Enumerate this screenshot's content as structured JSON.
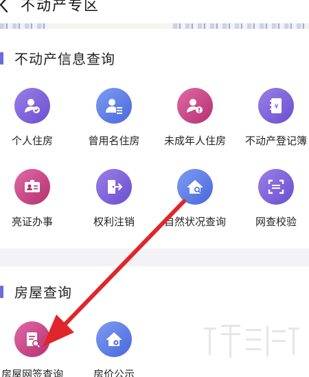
{
  "header": {
    "title": "不动产专区"
  },
  "sections": [
    {
      "title": "不动产信息查询",
      "items": [
        {
          "label": "个人住房",
          "icon": "person-house-icon",
          "color": "#7b5fd6"
        },
        {
          "label": "曾用名住房",
          "icon": "person-list-icon",
          "color": "#5f7fe8"
        },
        {
          "label": "未成年人住房",
          "icon": "child-alert-icon",
          "color": "#c8448a"
        },
        {
          "label": "不动产登记簿",
          "icon": "register-book-icon",
          "color": "#7b5fd6"
        },
        {
          "label": "亮证办事",
          "icon": "id-card-icon",
          "color": "#c8448a"
        },
        {
          "label": "权利注销",
          "icon": "logout-door-icon",
          "color": "#7b5fd6"
        },
        {
          "label": "自然状况查询",
          "icon": "house-search-icon",
          "color": "#5f7fe8"
        },
        {
          "label": "网查校验",
          "icon": "scan-frame-icon",
          "color": "#7b5fd6"
        }
      ]
    },
    {
      "title": "房屋查询",
      "items": [
        {
          "label": "房屋网签查询",
          "icon": "contract-search-icon",
          "color": "#c8448a"
        },
        {
          "label": "房价公示",
          "icon": "house-price-icon",
          "color": "#5f7fe8"
        }
      ]
    }
  ],
  "colors": {
    "accent": "#6e6bd9",
    "arrow": "#e0262a"
  }
}
